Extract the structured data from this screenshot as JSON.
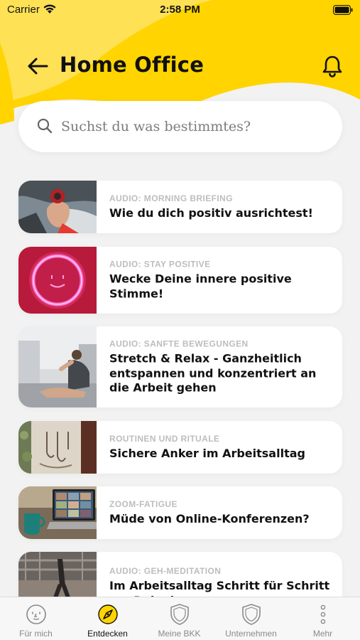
{
  "status_bar": {
    "carrier": "Carrier",
    "time": "2:58 PM"
  },
  "header": {
    "title": "Home Office"
  },
  "search": {
    "placeholder": "Suchst du was bestimmtes?"
  },
  "colors": {
    "accent": "#ffd400",
    "accent_light": "#ffe36a",
    "background": "#f2f2f2"
  },
  "cards": [
    {
      "category": "AUDIO: MORNING BRIEFING",
      "title": "Wie du dich positiv ausrichtest!"
    },
    {
      "category": "AUDIO: STAY POSITIVE",
      "title": "Wecke Deine innere positive Stimme!"
    },
    {
      "category": "AUDIO: SANFTE BEWEGUNGEN",
      "title": "Stretch & Relax - Ganzheitlich entspannen und konzentriert an die Arbeit gehen"
    },
    {
      "category": "ROUTINEN UND RITUALE",
      "title": "Sichere Anker im Arbeitsalltag"
    },
    {
      "category": "ZOOM-FATIGUE",
      "title": "Müde von Online-Konferenzen?"
    },
    {
      "category": "AUDIO: GEH-MEDITATION",
      "title": "Im Arbeitsalltag Schritt für Schritt zur Ruhe kommen"
    }
  ],
  "tabs": [
    {
      "label": "Für mich",
      "icon": "face-icon"
    },
    {
      "label": "Entdecken",
      "icon": "compass-icon",
      "active": true
    },
    {
      "label": "Meine BKK",
      "icon": "shield-icon"
    },
    {
      "label": "Unternehmen",
      "icon": "shield-icon"
    },
    {
      "label": "Mehr",
      "icon": "more-icon"
    }
  ]
}
